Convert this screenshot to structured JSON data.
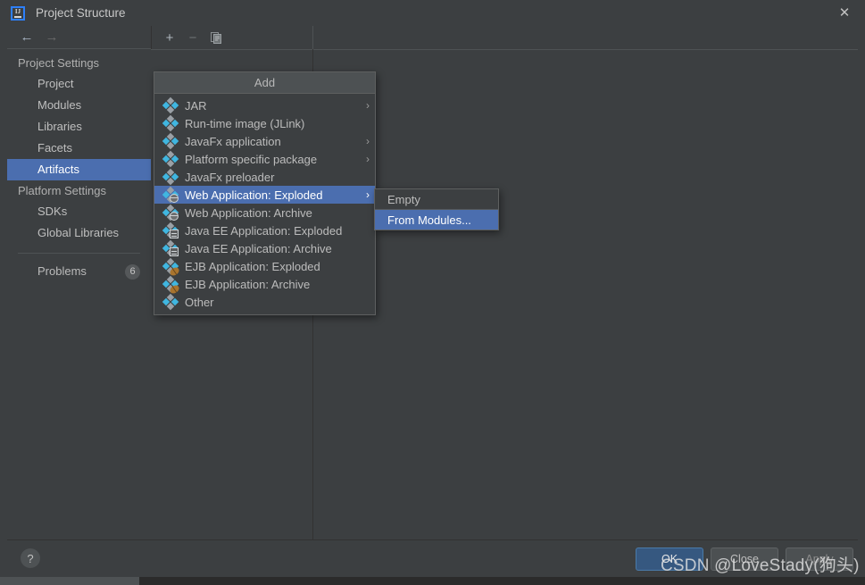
{
  "window": {
    "title": "Project Structure",
    "logo_icon": "intellij-idea-logo-icon",
    "close_icon": "close-icon"
  },
  "navbar": {
    "back_icon": "arrow-left-icon",
    "forward_icon": "arrow-right-icon"
  },
  "sidebar": {
    "groups": [
      {
        "label": "Project Settings",
        "items": [
          {
            "label": "Project",
            "selected": false
          },
          {
            "label": "Modules",
            "selected": false
          },
          {
            "label": "Libraries",
            "selected": false
          },
          {
            "label": "Facets",
            "selected": false
          },
          {
            "label": "Artifacts",
            "selected": true
          }
        ]
      },
      {
        "label": "Platform Settings",
        "items": [
          {
            "label": "SDKs",
            "selected": false
          },
          {
            "label": "Global Libraries",
            "selected": false
          }
        ]
      }
    ],
    "problems": {
      "label": "Problems",
      "count": "6"
    }
  },
  "toolbar": {
    "add_icon": "plus-icon",
    "remove_icon": "minus-icon",
    "copy_icon": "copy-icon"
  },
  "add_menu": {
    "title": "Add",
    "items": [
      {
        "label": "JAR",
        "icon": "artifact-icon",
        "submenu": true,
        "selected": false
      },
      {
        "label": "Run-time image (JLink)",
        "icon": "artifact-icon",
        "submenu": false,
        "selected": false
      },
      {
        "label": "JavaFx application",
        "icon": "artifact-icon",
        "submenu": true,
        "selected": false
      },
      {
        "label": "Platform specific package",
        "icon": "artifact-icon",
        "submenu": true,
        "selected": false
      },
      {
        "label": "JavaFx preloader",
        "icon": "artifact-icon",
        "submenu": false,
        "selected": false
      },
      {
        "label": "Web Application: Exploded",
        "icon": "web-artifact-icon",
        "submenu": true,
        "selected": true
      },
      {
        "label": "Web Application: Archive",
        "icon": "web-artifact-icon",
        "submenu": false,
        "selected": false
      },
      {
        "label": "Java EE Application: Exploded",
        "icon": "javaee-artifact-icon",
        "submenu": false,
        "selected": false
      },
      {
        "label": "Java EE Application: Archive",
        "icon": "javaee-artifact-icon",
        "submenu": false,
        "selected": false
      },
      {
        "label": "EJB Application: Exploded",
        "icon": "ejb-artifact-icon",
        "submenu": false,
        "selected": false
      },
      {
        "label": "EJB Application: Archive",
        "icon": "ejb-artifact-icon",
        "submenu": false,
        "selected": false
      },
      {
        "label": "Other",
        "icon": "artifact-icon",
        "submenu": false,
        "selected": false
      }
    ],
    "submenu_arrow_icon": "chevron-right-icon"
  },
  "from_menu": {
    "items": [
      {
        "label": "Empty",
        "selected": false
      },
      {
        "label": "From Modules...",
        "selected": true
      }
    ]
  },
  "footer": {
    "help_label": "?",
    "ok_label": "OK",
    "close_label": "Close",
    "apply_label": "Apply"
  },
  "watermark": {
    "text": "CSDN @LoveStady(狗头)"
  },
  "colors": {
    "background": "#3c3f41",
    "selection_blue": "#4b6eaf",
    "ok_button_blue": "#365880",
    "icon_cyan": "#40b6e0",
    "text": "#bbbbbb"
  }
}
